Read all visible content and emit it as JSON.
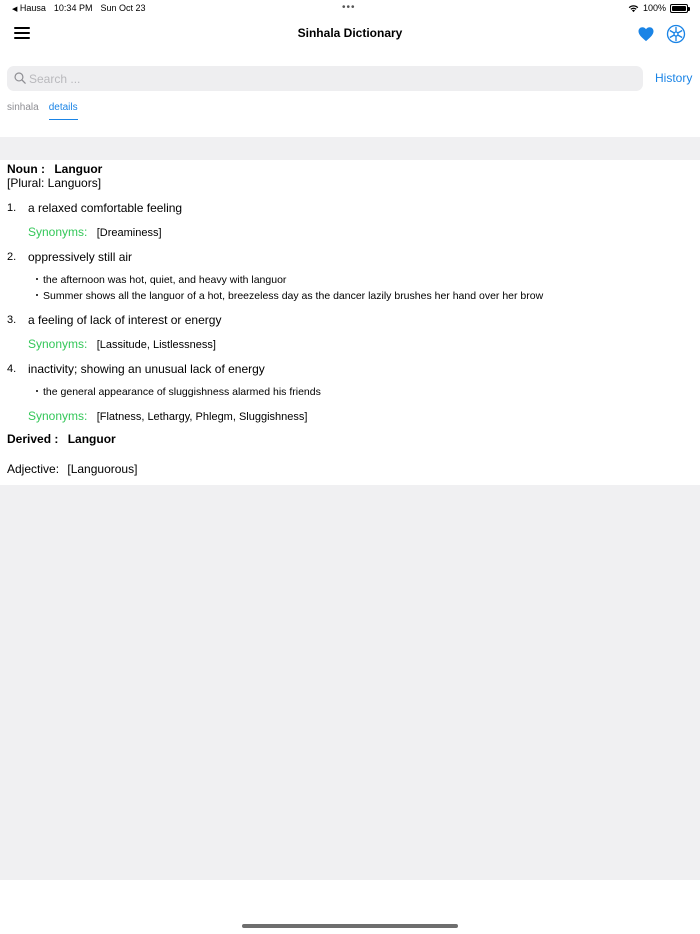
{
  "status_bar": {
    "back_label": "Hausa",
    "time": "10:34 PM",
    "date": "Sun Oct 23",
    "battery_percent": "100%",
    "battery_level": 1.0
  },
  "nav": {
    "title": "Sinhala Dictionary",
    "icons": [
      "menu-icon",
      "heart-icon",
      "gear-icon"
    ],
    "accent_color": "#1a84e6"
  },
  "search": {
    "placeholder": "Search ...",
    "value": "",
    "history_label": "History"
  },
  "tabs": [
    {
      "label": "sinhala",
      "active": false
    },
    {
      "label": "details",
      "active": true
    }
  ],
  "entry": {
    "pos_label": "Noun :",
    "word": "Languor",
    "plural": "[Plural: Languors]",
    "synonyms_label": "Synonyms:",
    "synonyms_color": "#34c759",
    "senses": [
      {
        "num": "1.",
        "text": "a relaxed comfortable feeling",
        "examples": [],
        "synonyms": "[Dreaminess]"
      },
      {
        "num": "2.",
        "text": "oppressively still air",
        "examples": [
          "the afternoon was hot, quiet, and heavy with languor",
          "Summer shows all the languor of a hot, breezeless day as the dancer lazily brushes her hand over her brow"
        ],
        "synonyms": ""
      },
      {
        "num": "3.",
        "text": "a feeling of lack of interest or energy",
        "examples": [],
        "synonyms": "[Lassitude, Listlessness]"
      },
      {
        "num": "4.",
        "text": "inactivity; showing an unusual lack of energy",
        "examples": [
          "the general appearance of sluggishness alarmed his friends"
        ],
        "synonyms": "[Flatness, Lethargy, Phlegm, Sluggishness]"
      }
    ],
    "derived_label": "Derived :",
    "derived_word": "Languor",
    "adjective_label": "Adjective:",
    "adjective_value": "[Languorous]"
  }
}
